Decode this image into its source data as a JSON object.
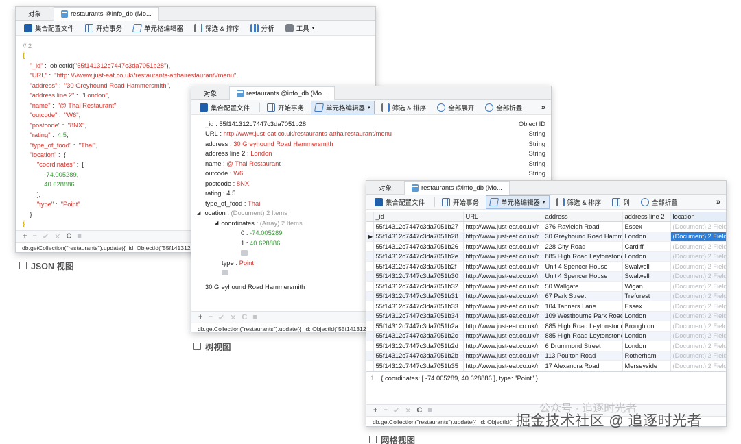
{
  "common": {
    "tab_object": "对象",
    "tab_collection": "restaurants @info_db (Mo...",
    "query_json": "db.getCollection(\"restaurants\").update({_id: ObjectId(\"55f141312c7447",
    "query_tree": "db.getCollection(\"restaurants\").update({_id: ObjectId(\"55f141312c7447c3",
    "query_grid": "db.getCollection(\"restaurants\").update({_id: ObjectId(\"",
    "footer_add": "+",
    "footer_remove": "−",
    "footer_check": "✔",
    "footer_cancel": "✕",
    "footer_refresh": "C",
    "footer_stop": "■"
  },
  "json_window": {
    "toolbar": [
      "集合配置文件",
      "开始事务",
      "单元格编辑器",
      "筛选 & 排序",
      "分析",
      "工具"
    ],
    "caption": "JSON 视图"
  },
  "tree_window": {
    "toolbar": [
      "集合配置文件",
      "开始事务",
      "单元格编辑器",
      "筛选 & 排序",
      "全部展开",
      "全部折叠"
    ],
    "rows": [
      {
        "key": "_id",
        "value": "55f141312c7447c3da7051b28",
        "type": "Object ID"
      },
      {
        "key": "URL",
        "value": "http://www.just-eat.co.uk/restaurants-atthairestaurant/menu",
        "type": "String"
      },
      {
        "key": "address",
        "value": "30 Greyhound Road Hammersmith",
        "type": "String"
      },
      {
        "key": "address line 2",
        "value": "London",
        "type": "String"
      },
      {
        "key": "name",
        "value": "@ Thai Restaurant",
        "type": "String"
      },
      {
        "key": "outcode",
        "value": "W6",
        "type": "String"
      },
      {
        "key": "postcode",
        "value": "8NX",
        "type": ""
      },
      {
        "key": "rating",
        "value": "4.5",
        "type": ""
      },
      {
        "key": "type_of_food",
        "value": "Thai",
        "type": ""
      }
    ],
    "location_key": "location",
    "location_hint": "(Document) 2 Items",
    "coordinates_key": "coordinates",
    "coordinates_hint": "(Array) 2 Items",
    "coord0_idx": "0",
    "coord0": "-74.005289",
    "coord1_idx": "1",
    "coord1": "40.628886",
    "type_key": "type",
    "type_value": "Point",
    "preview": "30 Greyhound Road Hammersmith",
    "caption": "树视图"
  },
  "grid_window": {
    "toolbar": [
      "集合配置文件",
      "开始事务",
      "单元格编辑器",
      "筛选 & 排序",
      "列",
      "全部折叠"
    ],
    "columns": [
      "_id",
      "URL",
      "address",
      "address line 2",
      "location"
    ],
    "rows": [
      [
        "55f14312c7447c3da7051b27",
        "http://www.just-eat.co.uk/r",
        "376 Rayleigh Road",
        "Essex",
        "(Document) 2 Fields"
      ],
      [
        "55f14312c7447c3da7051b28",
        "http://www.just-eat.co.uk/r",
        "30 Greyhound Road Hamm",
        "London",
        "(Document) 2 Fields"
      ],
      [
        "55f14312c7447c3da7051b26",
        "http://www.just-eat.co.uk/r",
        "228 City Road",
        "Cardiff",
        "(Document) 2 Fields"
      ],
      [
        "55f14312c7447c3da7051b2e",
        "http://www.just-eat.co.uk/r",
        "885 High Road Leytonstone",
        "London",
        "(Document) 2 Fields"
      ],
      [
        "55f14312c7447c3da7051b2f",
        "http://www.just-eat.co.uk/r",
        "Unit 4 Spencer House",
        "Swalwell",
        "(Document) 2 Fields"
      ],
      [
        "55f14312c7447c3da7051b30",
        "http://www.just-eat.co.uk/r",
        "Unit 4 Spencer House",
        "Swalwell",
        "(Document) 2 Fields"
      ],
      [
        "55f14312c7447c3da7051b32",
        "http://www.just-eat.co.uk/r",
        "50 Wallgate",
        "Wigan",
        "(Document) 2 Fields"
      ],
      [
        "55f14312c7447c3da7051b31",
        "http://www.just-eat.co.uk/r",
        "67 Park Street",
        "Treforest",
        "(Document) 2 Fields"
      ],
      [
        "55f14312c7447c3da7051b33",
        "http://www.just-eat.co.uk/r",
        "104 Tanners Lane",
        "Essex",
        "(Document) 2 Fields"
      ],
      [
        "55f14312c7447c3da7051b34",
        "http://www.just-eat.co.uk/r",
        "109 Westbourne Park Road",
        "London",
        "(Document) 2 Fields"
      ],
      [
        "55f14312c7447c3da7051b2a",
        "http://www.just-eat.co.uk/r",
        "885 High Road Leytonstone",
        "Broughton",
        "(Document) 2 Fields"
      ],
      [
        "55f14312c7447c3da7051b2c",
        "http://www.just-eat.co.uk/r",
        "885 High Road Leytonstone",
        "London",
        "(Document) 2 Fields"
      ],
      [
        "55f14312c7447c3da7051b2d",
        "http://www.just-eat.co.uk/r",
        "6 Drummond Street",
        "London",
        "(Document) 2 Fields"
      ],
      [
        "55f14312c7447c3da7051b2b",
        "http://www.just-eat.co.uk/r",
        "113 Poulton Road",
        "Rotherham",
        "(Document) 2 Fields"
      ],
      [
        "55f14312c7447c3da7051b35",
        "http://www.just-eat.co.uk/r",
        "17 Alexandra Road",
        "Merseyside",
        "(Document) 2 Fields"
      ]
    ],
    "detail_line": "1",
    "detail_text": "{  coordinates:  [  -74.005289,  40.628886  ],  type:  \"Point\"  }",
    "caption": "网格视图"
  },
  "watermark": "掘金技术社区 @ 追逐时光者",
  "watermark2": "公众号 · 追逐时光者"
}
